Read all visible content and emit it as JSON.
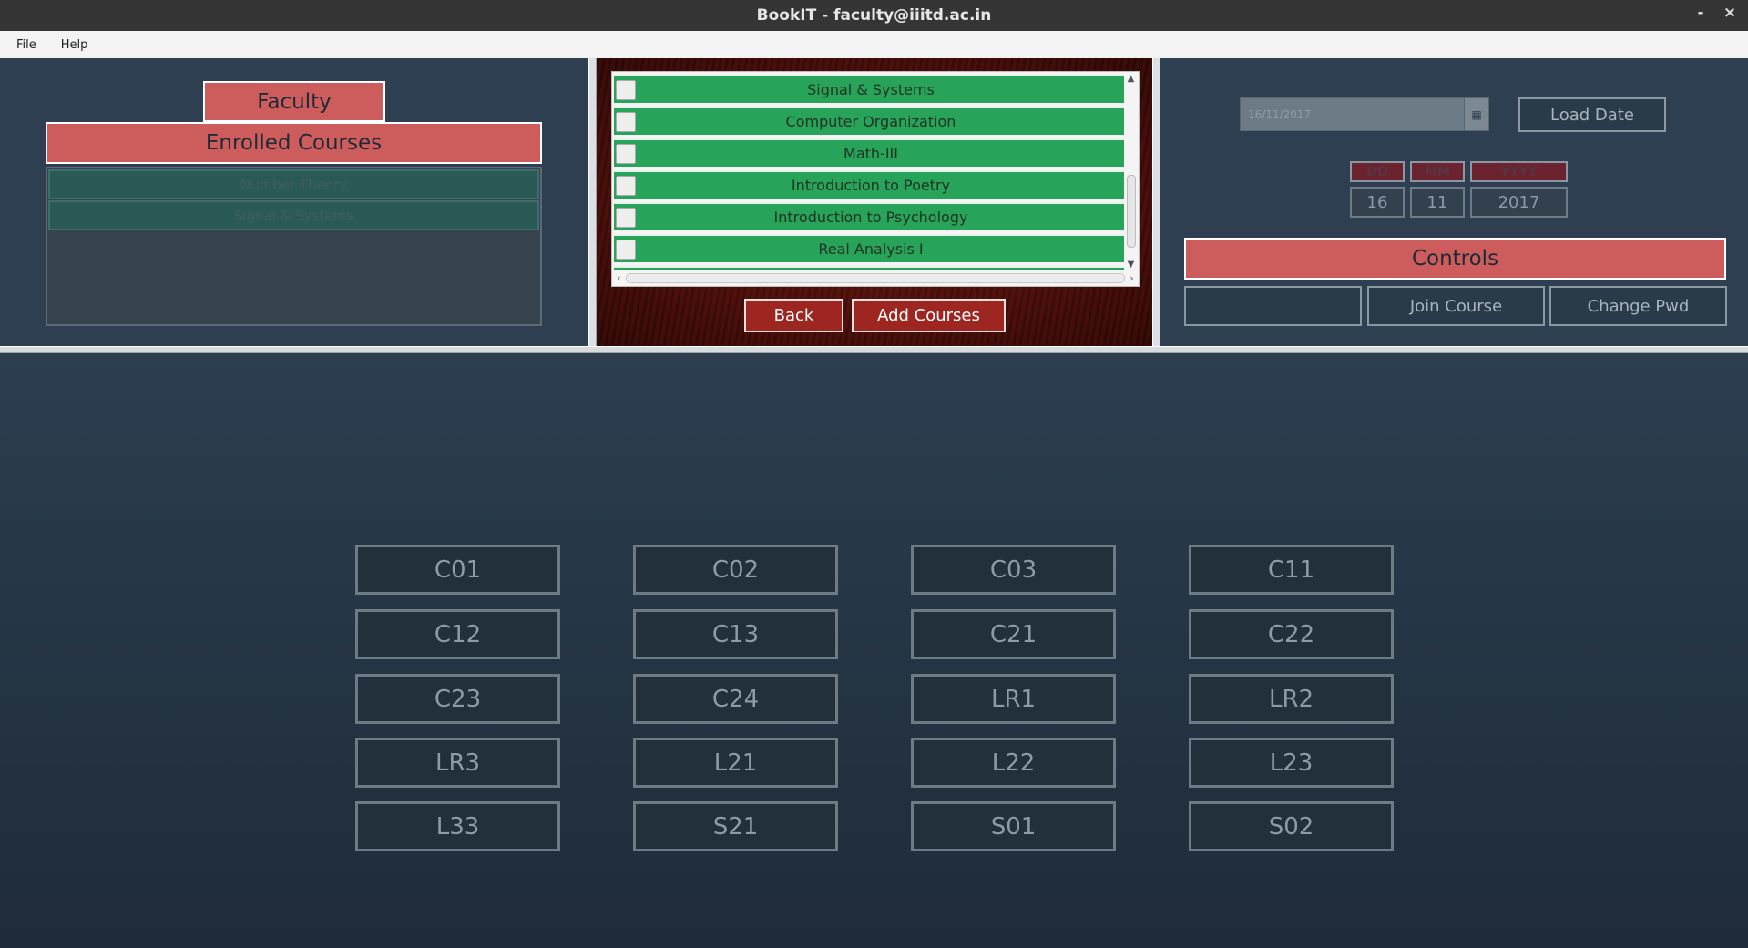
{
  "window": {
    "title": "BookIT - faculty@iiitd.ac.in",
    "minimize": "-",
    "close": "×"
  },
  "menu": [
    "File",
    "Help"
  ],
  "left_panel": {
    "role_label": "Faculty",
    "enrolled_header": "Enrolled Courses",
    "enrolled_courses": [
      "Number Theory",
      "Signal & Systems"
    ]
  },
  "middle_panel": {
    "courses": [
      "Signal & Systems",
      "Computer Organization",
      "Math-III",
      "Introduction to Poetry",
      "Introduction to Psychology",
      "Real Analysis I"
    ],
    "back_label": "Back",
    "add_label": "Add Courses"
  },
  "right_panel": {
    "date_value": "16/11/2017",
    "calendar_icon": "calendar-icon",
    "load_date_label": "Load Date",
    "labels": {
      "day": "DD",
      "month": "MM",
      "year": "YYYY"
    },
    "values": {
      "day": "16",
      "month": "11",
      "year": "2017"
    },
    "controls_header": "Controls",
    "control_buttons": [
      "",
      "Join Course",
      "Change Pwd"
    ]
  },
  "rooms": [
    [
      "C01",
      "C02",
      "C03",
      "C11"
    ],
    [
      "C12",
      "C13",
      "C21",
      "C22"
    ],
    [
      "C23",
      "C24",
      "LR1",
      "LR2"
    ],
    [
      "LR3",
      "L21",
      "L22",
      "L23"
    ],
    [
      "L33",
      "S21",
      "S01",
      "S02"
    ]
  ]
}
